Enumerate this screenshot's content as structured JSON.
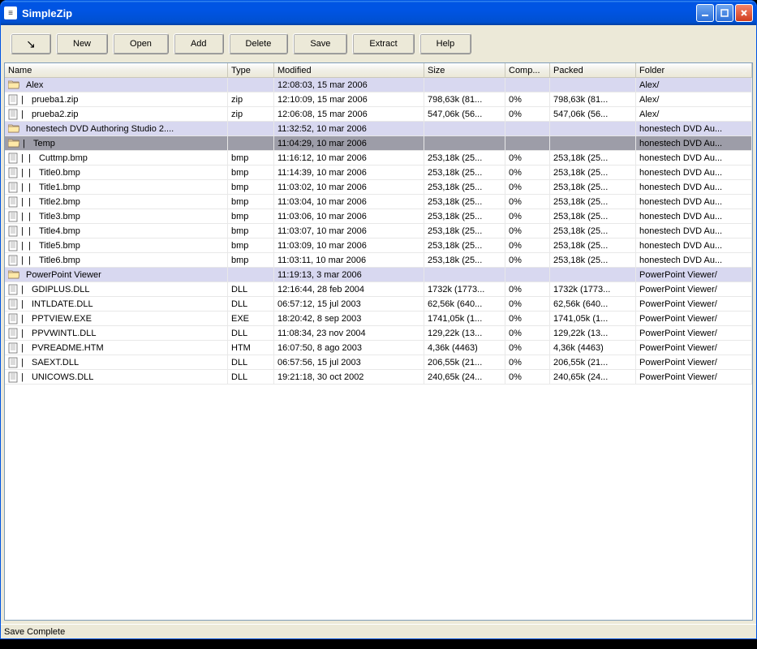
{
  "window": {
    "title": "SimpleZip"
  },
  "toolbar": {
    "tree_icon": "↘",
    "buttons": [
      "New",
      "Open",
      "Add",
      "Delete",
      "Save",
      "Extract",
      "Help"
    ]
  },
  "columns": [
    "Name",
    "Type",
    "Modified",
    "Size",
    "Comp...",
    "Packed",
    "Folder"
  ],
  "rows": [
    {
      "kind": "folder",
      "indent": 0,
      "name": "Alex",
      "type": "",
      "modified": "12:08:03, 15 mar 2006",
      "size": "",
      "comp": "",
      "packed": "",
      "folder": "Alex/"
    },
    {
      "kind": "file",
      "indent": 1,
      "name": "prueba1.zip",
      "type": "zip",
      "modified": "12:10:09, 15 mar 2006",
      "size": "798,63k  (81...",
      "comp": "0%",
      "packed": "798,63k  (81...",
      "folder": "Alex/"
    },
    {
      "kind": "file",
      "indent": 1,
      "name": "prueba2.zip",
      "type": "zip",
      "modified": "12:06:08, 15 mar 2006",
      "size": "547,06k  (56...",
      "comp": "0%",
      "packed": "547,06k  (56...",
      "folder": "Alex/"
    },
    {
      "kind": "folder",
      "indent": 0,
      "name": "honestech DVD Authoring Studio 2....",
      "type": "",
      "modified": "11:32:52, 10 mar 2006",
      "size": "",
      "comp": "",
      "packed": "",
      "folder": "honestech DVD Au..."
    },
    {
      "kind": "folder",
      "indent": 1,
      "name": "Temp",
      "type": "",
      "modified": "11:04:29, 10 mar 2006",
      "size": "",
      "comp": "",
      "packed": "",
      "folder": "honestech DVD Au...",
      "selected": true
    },
    {
      "kind": "file",
      "indent": 2,
      "name": "Cuttmp.bmp",
      "type": "bmp",
      "modified": "11:16:12, 10 mar 2006",
      "size": "253,18k  (25...",
      "comp": "0%",
      "packed": "253,18k  (25...",
      "folder": "honestech DVD Au..."
    },
    {
      "kind": "file",
      "indent": 2,
      "name": "Title0.bmp",
      "type": "bmp",
      "modified": "11:14:39, 10 mar 2006",
      "size": "253,18k  (25...",
      "comp": "0%",
      "packed": "253,18k  (25...",
      "folder": "honestech DVD Au..."
    },
    {
      "kind": "file",
      "indent": 2,
      "name": "Title1.bmp",
      "type": "bmp",
      "modified": "11:03:02, 10 mar 2006",
      "size": "253,18k  (25...",
      "comp": "0%",
      "packed": "253,18k  (25...",
      "folder": "honestech DVD Au..."
    },
    {
      "kind": "file",
      "indent": 2,
      "name": "Title2.bmp",
      "type": "bmp",
      "modified": "11:03:04, 10 mar 2006",
      "size": "253,18k  (25...",
      "comp": "0%",
      "packed": "253,18k  (25...",
      "folder": "honestech DVD Au..."
    },
    {
      "kind": "file",
      "indent": 2,
      "name": "Title3.bmp",
      "type": "bmp",
      "modified": "11:03:06, 10 mar 2006",
      "size": "253,18k  (25...",
      "comp": "0%",
      "packed": "253,18k  (25...",
      "folder": "honestech DVD Au..."
    },
    {
      "kind": "file",
      "indent": 2,
      "name": "Title4.bmp",
      "type": "bmp",
      "modified": "11:03:07, 10 mar 2006",
      "size": "253,18k  (25...",
      "comp": "0%",
      "packed": "253,18k  (25...",
      "folder": "honestech DVD Au..."
    },
    {
      "kind": "file",
      "indent": 2,
      "name": "Title5.bmp",
      "type": "bmp",
      "modified": "11:03:09, 10 mar 2006",
      "size": "253,18k  (25...",
      "comp": "0%",
      "packed": "253,18k  (25...",
      "folder": "honestech DVD Au..."
    },
    {
      "kind": "file",
      "indent": 2,
      "name": "Title6.bmp",
      "type": "bmp",
      "modified": "11:03:11, 10 mar 2006",
      "size": "253,18k  (25...",
      "comp": "0%",
      "packed": "253,18k  (25...",
      "folder": "honestech DVD Au..."
    },
    {
      "kind": "folder",
      "indent": 0,
      "name": "PowerPoint Viewer",
      "type": "",
      "modified": "11:19:13, 3 mar 2006",
      "size": "",
      "comp": "",
      "packed": "",
      "folder": "PowerPoint Viewer/"
    },
    {
      "kind": "file",
      "indent": 1,
      "name": "GDIPLUS.DLL",
      "type": "DLL",
      "modified": "12:16:44, 28 feb 2004",
      "size": "1732k  (1773...",
      "comp": "0%",
      "packed": "1732k  (1773...",
      "folder": "PowerPoint Viewer/"
    },
    {
      "kind": "file",
      "indent": 1,
      "name": "INTLDATE.DLL",
      "type": "DLL",
      "modified": "06:57:12, 15 jul 2003",
      "size": "62,56k  (640...",
      "comp": "0%",
      "packed": "62,56k  (640...",
      "folder": "PowerPoint Viewer/"
    },
    {
      "kind": "file",
      "indent": 1,
      "name": "PPTVIEW.EXE",
      "type": "EXE",
      "modified": "18:20:42, 8 sep 2003",
      "size": "1741,05k  (1...",
      "comp": "0%",
      "packed": "1741,05k  (1...",
      "folder": "PowerPoint Viewer/"
    },
    {
      "kind": "file",
      "indent": 1,
      "name": "PPVWINTL.DLL",
      "type": "DLL",
      "modified": "11:08:34, 23 nov 2004",
      "size": "129,22k  (13...",
      "comp": "0%",
      "packed": "129,22k  (13...",
      "folder": "PowerPoint Viewer/"
    },
    {
      "kind": "file",
      "indent": 1,
      "name": "PVREADME.HTM",
      "type": "HTM",
      "modified": "16:07:50, 8 ago 2003",
      "size": "4,36k  (4463)",
      "comp": "0%",
      "packed": "4,36k  (4463)",
      "folder": "PowerPoint Viewer/"
    },
    {
      "kind": "file",
      "indent": 1,
      "name": "SAEXT.DLL",
      "type": "DLL",
      "modified": "06:57:56, 15 jul 2003",
      "size": "206,55k  (21...",
      "comp": "0%",
      "packed": "206,55k  (21...",
      "folder": "PowerPoint Viewer/"
    },
    {
      "kind": "file",
      "indent": 1,
      "name": "UNICOWS.DLL",
      "type": "DLL",
      "modified": "19:21:18, 30 oct 2002",
      "size": "240,65k  (24...",
      "comp": "0%",
      "packed": "240,65k  (24...",
      "folder": "PowerPoint Viewer/"
    }
  ],
  "status": "Save Complete"
}
